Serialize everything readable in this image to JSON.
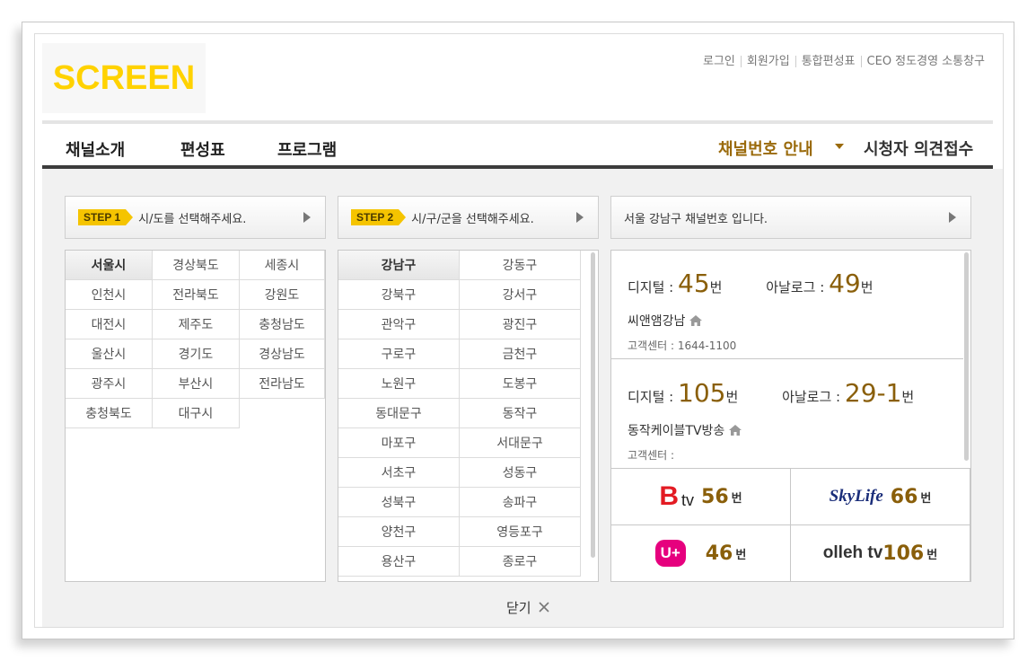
{
  "header": {
    "logo_text": "SCREEN",
    "util_links": [
      "로그인",
      "회원가입",
      "통합편성표",
      "CEO 정도경영 소통창구"
    ]
  },
  "nav": {
    "items": [
      "채널소개",
      "편성표",
      "프로그램"
    ],
    "channel_guide": "채널번호 안내",
    "opinion": "시청자 의견접수"
  },
  "step1": {
    "badge": "STEP 1",
    "text": "시/도를 선택해주세요."
  },
  "step2": {
    "badge": "STEP 2",
    "text": "시/구/군을 선택해주세요."
  },
  "step3": {
    "text": "서울 강남구 채널번호 입니다."
  },
  "cities": [
    "서울시",
    "경상북도",
    "세종시",
    "인천시",
    "전라북도",
    "강원도",
    "대전시",
    "제주도",
    "충청남도",
    "울산시",
    "경기도",
    "경상남도",
    "광주시",
    "부산시",
    "전라남도",
    "충청북도",
    "대구시"
  ],
  "selected_city": "서울시",
  "districts": [
    "강남구",
    "강동구",
    "강북구",
    "강서구",
    "관악구",
    "광진구",
    "구로구",
    "금천구",
    "노원구",
    "도봉구",
    "동대문구",
    "동작구",
    "마포구",
    "서대문구",
    "서초구",
    "성동구",
    "성북구",
    "송파구",
    "양천구",
    "영등포구",
    "용산구",
    "종로구"
  ],
  "selected_district": "강남구",
  "entries": [
    {
      "digital_label": "디지털 :",
      "digital": "45",
      "analog_label": "아날로그 :",
      "analog": "49",
      "unit": "번",
      "name": "씨앤앰강남",
      "cs": "고객센터 : 1644-1100"
    },
    {
      "digital_label": "디지털 :",
      "digital": "105",
      "analog_label": "아날로그 :",
      "analog": "29-1",
      "unit": "번",
      "name": "동작케이블TV방송",
      "cs": "고객센터 :"
    }
  ],
  "brands": [
    {
      "name": "B tv",
      "num": "56",
      "unit": "번"
    },
    {
      "name": "SkyLife",
      "num": "66",
      "unit": "번"
    },
    {
      "name": "U+",
      "num": "46",
      "unit": "번"
    },
    {
      "name": "olleh tv",
      "num": "106",
      "unit": "번"
    }
  ],
  "close_label": "닫기",
  "colors": {
    "logo": "#ffd200",
    "accent": "#9a6a0b",
    "badge": "#f5c400",
    "uplus": "#e6007e",
    "btv": "#e31b23",
    "skylife": "#1b2e7a"
  }
}
